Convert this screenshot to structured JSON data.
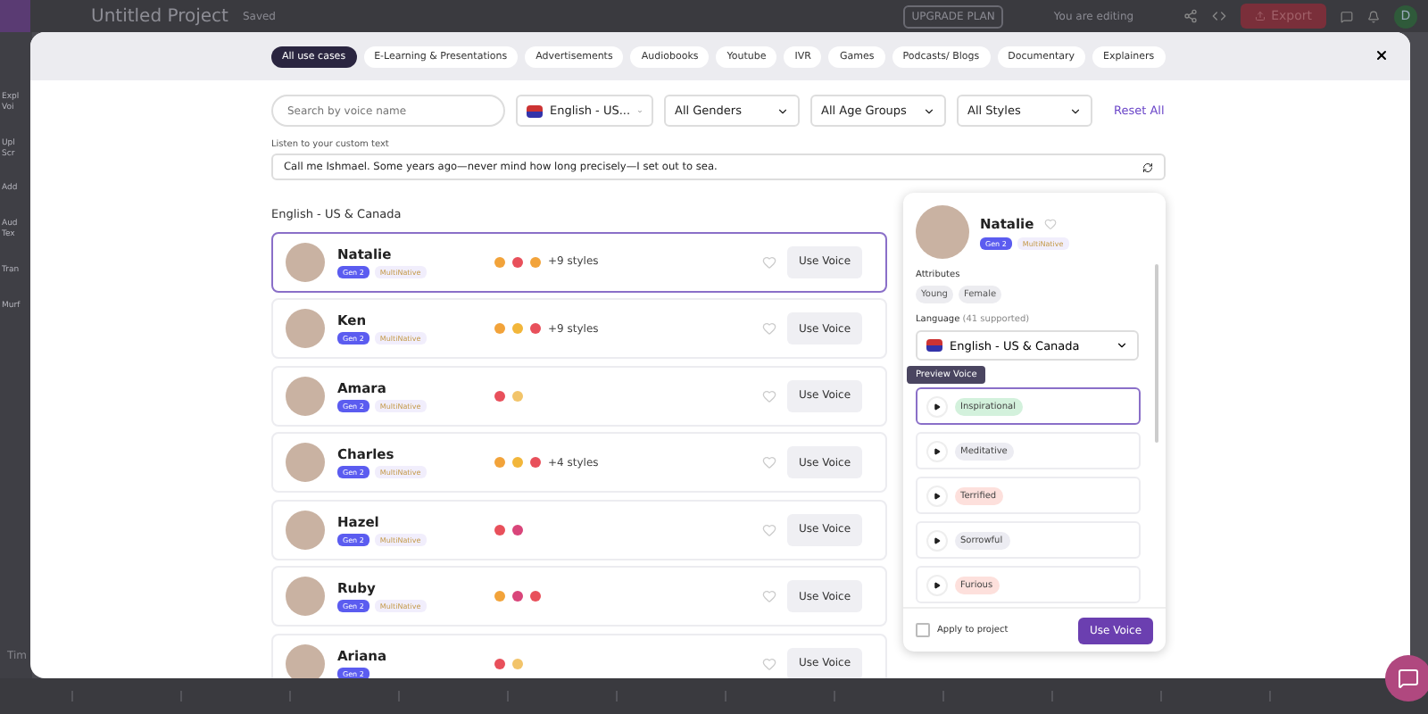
{
  "app_bar": {
    "project_title": "Untitled Project",
    "save_status": "Saved",
    "upgrade_button": "UPGRADE PLAN",
    "editing_status": "You are editing",
    "export_button": "Export",
    "avatar_initial": "D"
  },
  "sidebar": {
    "items": [
      "Expl\nVoi",
      "Upl\nScr",
      "Add",
      "Aud\nTex",
      "Tran",
      "Murf"
    ]
  },
  "timeline_label": "Tim",
  "modal": {
    "use_case_tabs": [
      {
        "label": "All use cases",
        "selected": true
      },
      {
        "label": "E-Learning & Presentations",
        "selected": false
      },
      {
        "label": "Advertisements",
        "selected": false
      },
      {
        "label": "Audiobooks",
        "selected": false
      },
      {
        "label": "Youtube",
        "selected": false
      },
      {
        "label": "IVR",
        "selected": false
      },
      {
        "label": "Games",
        "selected": false
      },
      {
        "label": "Podcasts/ Blogs",
        "selected": false
      },
      {
        "label": "Documentary",
        "selected": false
      },
      {
        "label": "Explainers",
        "selected": false
      }
    ],
    "search": {
      "placeholder": "Search by voice name"
    },
    "filters": [
      {
        "kind": "language",
        "value": "English - US..."
      },
      {
        "kind": "select",
        "value": "All Genders"
      },
      {
        "kind": "select",
        "value": "All Age Groups"
      },
      {
        "kind": "select",
        "value": "All Styles"
      }
    ],
    "reset_link": "Reset All",
    "custom_text": {
      "label": "Listen to your custom text",
      "value": "Call me Ishmael. Some years ago—never mind how long precisely—I set out to sea."
    },
    "section_title": "English - US & Canada",
    "voices": [
      {
        "name": "Natalie",
        "selected": true,
        "favorite": false,
        "tags": [
          {
            "kind": "gen",
            "label": "Gen 2"
          },
          {
            "kind": "multi",
            "label": "MultiNative"
          }
        ],
        "style_icons": [
          {
            "color": "#f2a33a"
          },
          {
            "color": "#e8505b"
          },
          {
            "color": "#f2a33a"
          }
        ],
        "more_styles": "+9 styles",
        "button": "Use Voice"
      },
      {
        "name": "Ken",
        "selected": false,
        "favorite": false,
        "tags": [
          {
            "kind": "gen",
            "label": "Gen 2"
          },
          {
            "kind": "multi",
            "label": "MultiNative"
          }
        ],
        "style_icons": [
          {
            "color": "#f2a33a"
          },
          {
            "color": "#f2b63a"
          },
          {
            "color": "#e8505b"
          }
        ],
        "more_styles": "+9 styles",
        "button": "Use Voice"
      },
      {
        "name": "Amara",
        "selected": false,
        "favorite": false,
        "tags": [
          {
            "kind": "gen",
            "label": "Gen 2"
          },
          {
            "kind": "multi",
            "label": "MultiNative"
          }
        ],
        "style_icons": [
          {
            "color": "#e8505b"
          },
          {
            "color": "#f2c46a"
          }
        ],
        "button": "Use Voice"
      },
      {
        "name": "Charles",
        "selected": false,
        "favorite": false,
        "tags": [
          {
            "kind": "gen",
            "label": "Gen 2"
          },
          {
            "kind": "multi",
            "label": "MultiNative"
          }
        ],
        "style_icons": [
          {
            "color": "#f2a33a"
          },
          {
            "color": "#f2b63a"
          },
          {
            "color": "#e8505b"
          }
        ],
        "more_styles": "+4 styles",
        "button": "Use Voice"
      },
      {
        "name": "Hazel",
        "selected": false,
        "favorite": false,
        "tags": [
          {
            "kind": "gen",
            "label": "Gen 2"
          },
          {
            "kind": "multi",
            "label": "MultiNative"
          }
        ],
        "style_icons": [
          {
            "color": "#e8505b"
          },
          {
            "color": "#d9457a"
          }
        ],
        "button": "Use Voice"
      },
      {
        "name": "Ruby",
        "selected": false,
        "favorite": false,
        "tags": [
          {
            "kind": "gen",
            "label": "Gen 2"
          },
          {
            "kind": "multi",
            "label": "MultiNative"
          }
        ],
        "style_icons": [
          {
            "color": "#f2a33a"
          },
          {
            "color": "#d9457a"
          },
          {
            "color": "#e8505b"
          }
        ],
        "button": "Use Voice"
      },
      {
        "name": "Ariana",
        "selected": false,
        "favorite": false,
        "tags": [
          {
            "kind": "gen",
            "label": "Gen 2"
          }
        ],
        "style_icons": [
          {
            "color": "#e8505b"
          },
          {
            "color": "#f2c46a"
          }
        ],
        "button": "Use Voice"
      }
    ],
    "detail": {
      "name": "Natalie",
      "favorite": false,
      "tags": [
        {
          "kind": "gen",
          "label": "Gen 2"
        },
        {
          "kind": "multi",
          "label": "MultiNative"
        }
      ],
      "attributes_label": "Attributes",
      "attributes": [
        "Young",
        "Female"
      ],
      "language_label": "Language",
      "language_count": "(41 supported)",
      "language_value": "English - US & Canada",
      "tooltip": "Preview Voice",
      "styles": [
        {
          "label": "Inspirational",
          "selected": true,
          "color": "#d3f1dc"
        },
        {
          "label": "Meditative",
          "selected": false,
          "color": "#ececf2"
        },
        {
          "label": "Terrified",
          "selected": false,
          "color": "#fde0dc"
        },
        {
          "label": "Sorrowful",
          "selected": false,
          "color": "#ececf2"
        },
        {
          "label": "Furious",
          "selected": false,
          "color": "#fde0dc"
        }
      ],
      "apply_checkbox": {
        "label": "Apply to project",
        "checked": false
      },
      "button": "Use Voice"
    }
  }
}
